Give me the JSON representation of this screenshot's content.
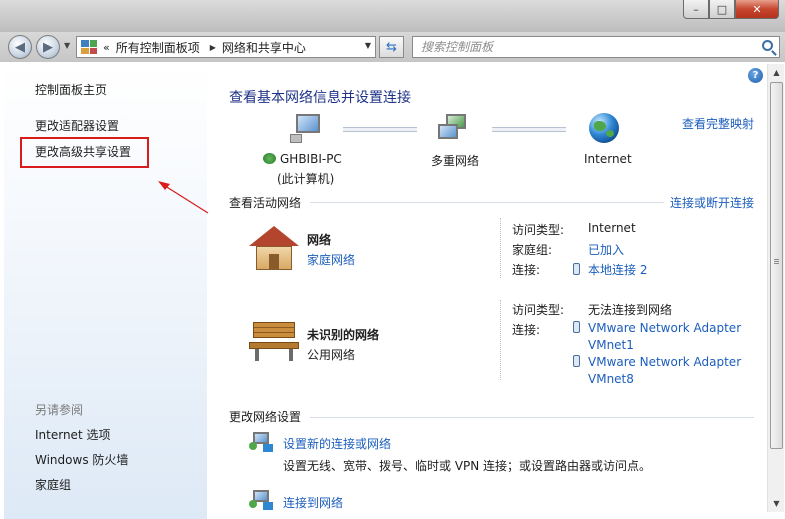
{
  "address": {
    "prefix": "«",
    "segments": [
      "所有控制面板项",
      "网络和共享中心"
    ],
    "search_placeholder": "搜索控制面板"
  },
  "sidebar": {
    "home": "控制面板主页",
    "adapter": "更改适配器设置",
    "advanced_sharing": "更改高级共享设置",
    "see_also": "另请参阅",
    "internet_options": "Internet 选项",
    "firewall": "Windows 防火墙",
    "homegroup": "家庭组"
  },
  "main": {
    "title": "查看基本网络信息并设置连接",
    "full_map": "查看完整映射",
    "map": {
      "computer_name": "GHBIBI-PC",
      "computer_sub": "(此计算机)",
      "middle": "多重网络",
      "internet": "Internet"
    },
    "active_title": "查看活动网络",
    "connect_disconnect": "连接或断开连接",
    "networks": [
      {
        "name": "网络",
        "type": "家庭网络",
        "access_label": "访问类型:",
        "access_value": "Internet",
        "homegroup_label": "家庭组:",
        "homegroup_value": "已加入",
        "conn_label": "连接:",
        "conn_value": "本地连接 2"
      },
      {
        "name": "未识别的网络",
        "type": "公用网络",
        "access_label": "访问类型:",
        "access_value": "无法连接到网络",
        "conn_label": "连接:",
        "conn_value_1a": "VMware Network Adapter",
        "conn_value_1b": "VMnet1",
        "conn_value_2a": "VMware Network Adapter",
        "conn_value_2b": "VMnet8"
      }
    ],
    "change_title": "更改网络设置",
    "tasks": [
      {
        "title": "设置新的连接或网络",
        "desc": "设置无线、宽带、拨号、临时或 VPN 连接；或设置路由器或访问点。"
      },
      {
        "title": "连接到网络"
      }
    ]
  },
  "colors": {
    "link": "#1c5ebd",
    "heading": "#1e3287",
    "annotation": "#d81b1b"
  }
}
